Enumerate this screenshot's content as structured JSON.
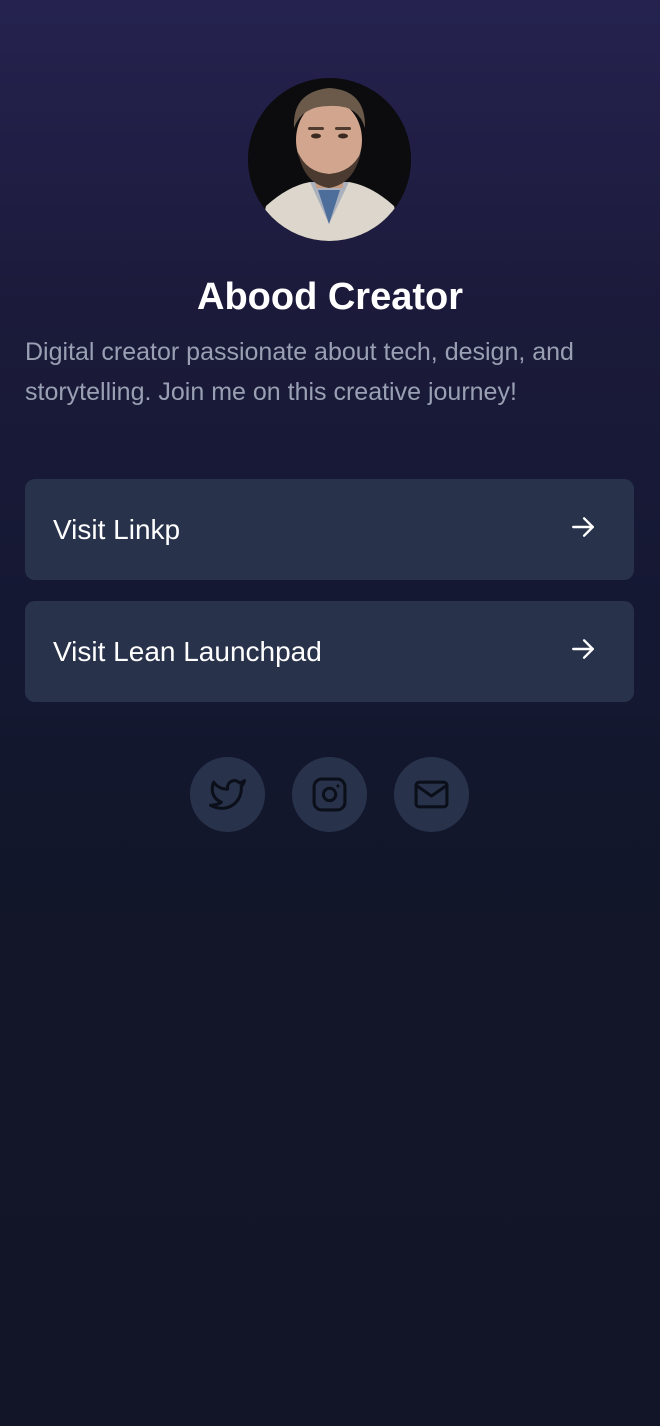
{
  "profile": {
    "name": "Abood Creator",
    "bio": "Digital creator passionate about tech, design, and storytelling. Join me on this creative journey!"
  },
  "links": [
    {
      "label": "Visit Linkp",
      "icon": "arrow-right-icon"
    },
    {
      "label": "Visit Lean Launchpad",
      "icon": "arrow-right-icon"
    }
  ],
  "socials": [
    {
      "icon": "twitter-icon"
    },
    {
      "icon": "instagram-icon"
    },
    {
      "icon": "mail-icon"
    }
  ],
  "colors": {
    "background_top": "#25224f",
    "background_bottom": "#111527",
    "button_background": "#28334b",
    "text_primary": "#ffffff",
    "text_secondary": "#9aa0b3",
    "social_icon": "#0b0f1a"
  }
}
